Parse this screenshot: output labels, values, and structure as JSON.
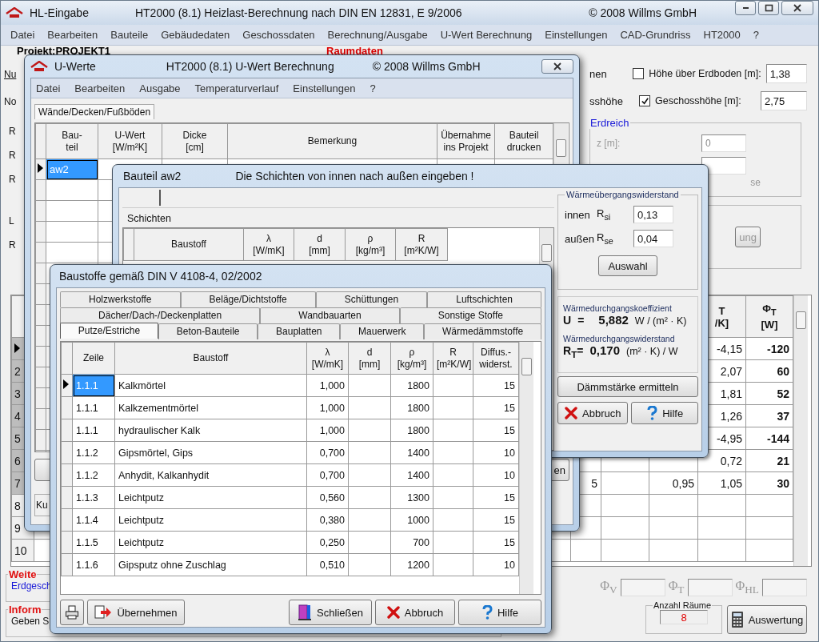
{
  "main_window": {
    "title": "HL-Eingabe",
    "subtitle": "HT2000 (8.1)  Heizlast-Berechnung nach DIN EN 12831, E 9/2006",
    "copyright": "© 2008 Willms GmbH",
    "menu": [
      "Datei",
      "Bearbeiten",
      "Bauteile",
      "Gebäudedaten",
      "Geschossdaten",
      "Berechnung/Ausgabe",
      "U-Wert Berechnung",
      "Einstellungen",
      "CAD-Grundriss",
      "HT2000",
      "?"
    ],
    "project_label": "Projekt:PROJEKT1",
    "section_title": "Raumdaten",
    "left_fragments": [
      "Nu",
      "No"
    ],
    "room_fragments": [
      "R",
      "R",
      "R",
      "L",
      "R"
    ],
    "height_fields": [
      {
        "fragment": "nen",
        "label": "Höhe über Erdboden [m]:",
        "checked": false,
        "value": "1,38"
      },
      {
        "fragment": "sshöhe",
        "label": "Geschosshöhe [m]:",
        "checked": true,
        "value": "2,75"
      }
    ],
    "erdreich": {
      "title": "Erdreich",
      "z_label": "z [m]:",
      "z_value": "0",
      "fragment": "se"
    },
    "fragment_button": "ung",
    "table": {
      "columns": [
        {},
        {},
        {},
        {
          "lines": [
            "T",
            "/K]"
          ]
        },
        {
          "lines": [
            "Φ$_{T}$",
            "[W]"
          ]
        }
      ],
      "rows": [
        {
          "selected": true,
          "cells": [
            null,
            null,
            null,
            "-4,15",
            "-120"
          ]
        },
        {
          "number": "2",
          "selected": false,
          "cells": [
            null,
            null,
            null,
            "2,07",
            "60"
          ]
        },
        {
          "number": "3",
          "selected": false,
          "cells": [
            null,
            null,
            null,
            "1,81",
            "52"
          ]
        },
        {
          "number": "4",
          "selected": false,
          "cells": [
            null,
            null,
            null,
            "1,26",
            "37"
          ]
        },
        {
          "number": "5",
          "selected": false,
          "cells": [
            null,
            null,
            null,
            "-4,95",
            "-144"
          ]
        },
        {
          "number": "6",
          "selected": false,
          "cells": [
            null,
            null,
            null,
            "0,72",
            "21"
          ]
        },
        {
          "number": "7",
          "selected": false,
          "cells": [
            "5",
            null,
            "0,95",
            "1,05",
            "30"
          ]
        },
        {
          "number": "8",
          "selected": false
        },
        {
          "number": "9",
          "selected": false
        },
        {
          "number": "10",
          "selected": false
        }
      ]
    },
    "groups": [
      {
        "title": "Weite",
        "text": "Erdgesch"
      },
      {
        "title": "Inform",
        "text": "Geben S"
      }
    ],
    "phi_labels": [
      "Φ$_{V}$",
      "Φ$_{T}$",
      "Φ$_{HL}$"
    ],
    "room_count": {
      "title": "Anzahl Räume",
      "value": "8"
    },
    "evaluate_button": "Auswertung"
  },
  "u_values_window": {
    "title": "U-Werte",
    "subtitle": "HT2000 (8.1)  U-Wert Berechnung",
    "copyright": "© 2008 Willms GmbH",
    "menu": [
      "Datei",
      "Bearbeiten",
      "Ausgabe",
      "Temperaturverlauf",
      "Einstellungen",
      "?"
    ],
    "tab": "Wände/Decken/Fußböden",
    "columns": [
      {
        "lines": [
          "Bau-",
          "teil"
        ]
      },
      {
        "lines": [
          "U-Wert",
          "[W/m²K]"
        ]
      },
      {
        "lines": [
          "Dicke",
          "[cm]"
        ]
      },
      {
        "lines": [
          "Bemerkung"
        ]
      },
      {
        "lines": [
          "Übernahme",
          "ins Projekt"
        ]
      },
      {
        "lines": [
          "Bauteil",
          "drucken"
        ]
      }
    ],
    "rows": [
      {
        "selected": true,
        "bauteil": "aw2"
      }
    ],
    "fragment_button": "en",
    "fragment_text": "Ku"
  },
  "component_window": {
    "title": "Bauteil aw2",
    "instruction": "Die Schichten von innen nach außen eingeben !",
    "layers_label": "Schichten",
    "columns": [
      {
        "lines": [
          "Baustoff"
        ]
      },
      {
        "lines": [
          "λ",
          "[W/mK]"
        ]
      },
      {
        "lines": [
          "d",
          "[mm]"
        ]
      },
      {
        "lines": [
          "ρ",
          "[kg/m³]"
        ]
      },
      {
        "lines": [
          "R",
          "[m²K/W]"
        ]
      }
    ],
    "resistance": {
      "title": "Wärmeübergangswiderstand",
      "rows": [
        {
          "label": "innen",
          "symbol": "R$_{si}$",
          "value": "0,13"
        },
        {
          "label": "außen",
          "symbol": "R$_{se}$",
          "value": "0,04"
        }
      ],
      "button": "Auswahl"
    },
    "results": [
      {
        "title": "Wärmedurchgangskoeffizient",
        "symbol": "U",
        "eq": "=",
        "value": "5,882",
        "unit": "W / (m² · K)"
      },
      {
        "title": "Wärmedurchgangswiderstand",
        "symbol": "R$_{T}$=",
        "value": "0,170",
        "unit": "(m² · K) / W"
      }
    ],
    "insulation_button": "Dämmstärke ermitteln",
    "buttons": [
      {
        "kind": "cancel",
        "label": "Abbruch"
      },
      {
        "kind": "help",
        "label": "Hilfe"
      }
    ]
  },
  "materials_window": {
    "title": "Baustoffe gemäß DIN V 4108-4, 02/2002",
    "tab_rows": [
      [
        {
          "label": "Holzwerkstoffe",
          "selected": false
        },
        {
          "label": "Beläge/Dichtstoffe",
          "selected": false
        },
        {
          "label": "Schüttungen",
          "selected": false
        },
        {
          "label": "Luftschichten",
          "selected": false
        }
      ],
      [
        {
          "label": "Dächer/Dach-/Deckenplatten",
          "selected": false
        },
        {
          "label": "Wandbauarten",
          "selected": false
        },
        {
          "label": "Sonstige Stoffe",
          "selected": false
        }
      ],
      [
        {
          "label": "Putze/Estriche",
          "selected": true
        },
        {
          "label": "Beton-Bauteile",
          "selected": false
        },
        {
          "label": "Bauplatten",
          "selected": false
        },
        {
          "label": "Mauerwerk",
          "selected": false
        },
        {
          "label": "Wärmedämmstoffe",
          "selected": false
        }
      ]
    ],
    "columns": [
      {
        "lines": [
          "Zeile"
        ]
      },
      {
        "lines": [
          "Baustoff"
        ]
      },
      {
        "lines": [
          "λ",
          "[W/mK]"
        ]
      },
      {
        "lines": [
          "d",
          "[mm]"
        ]
      },
      {
        "lines": [
          "ρ",
          "[kg/m³]"
        ]
      },
      {
        "lines": [
          "R",
          "[m²K/W]"
        ]
      },
      {
        "lines": [
          "Diffus.-",
          "widerst."
        ]
      }
    ],
    "rows": [
      {
        "selected": true,
        "cells": [
          "1.1.1",
          "Kalkmörtel",
          "1,000",
          null,
          "1800",
          null,
          "15"
        ]
      },
      {
        "selected": false,
        "cells": [
          "1.1.1",
          "Kalkzementmörtel",
          "1,000",
          null,
          "1800",
          null,
          "15"
        ]
      },
      {
        "selected": false,
        "cells": [
          "1.1.1",
          "hydraulischer Kalk",
          "1,000",
          null,
          "1800",
          null,
          "15"
        ]
      },
      {
        "selected": false,
        "cells": [
          "1.1.2",
          "Gipsmörtel, Gips",
          "0,700",
          null,
          "1400",
          null,
          "10"
        ]
      },
      {
        "selected": false,
        "cells": [
          "1.1.2",
          "Anhydit, Kalkanhydit",
          "0,700",
          null,
          "1400",
          null,
          "10"
        ]
      },
      {
        "selected": false,
        "cells": [
          "1.1.3",
          "Leichtputz",
          "0,560",
          null,
          "1300",
          null,
          "15"
        ]
      },
      {
        "selected": false,
        "cells": [
          "1.1.4",
          "Leichtputz",
          "0,380",
          null,
          "1000",
          null,
          "15"
        ]
      },
      {
        "selected": false,
        "cells": [
          "1.1.5",
          "Leichtputz",
          "0,250",
          null,
          "700",
          null,
          "15"
        ]
      },
      {
        "selected": false,
        "cells": [
          "1.1.6",
          "Gipsputz ohne  Zuschlag",
          "0,510",
          null,
          "1200",
          null,
          "10"
        ]
      }
    ],
    "buttons": [
      {
        "kind": "print"
      },
      {
        "kind": "accept",
        "label": "Übernehmen"
      },
      {
        "kind": "close",
        "label": "Schließen"
      },
      {
        "kind": "cancel",
        "label": "Abbruch"
      },
      {
        "kind": "help",
        "label": "Hilfe"
      }
    ]
  }
}
